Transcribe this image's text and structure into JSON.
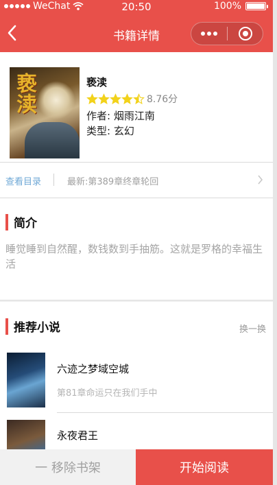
{
  "status_bar": {
    "carrier": "WeChat",
    "time": "20:50",
    "battery": "100%",
    "battery_level": 1.0
  },
  "nav": {
    "title": "书籍详情"
  },
  "book": {
    "cover_text": "亵渎",
    "name": "亵渎",
    "rating_stars": 4.5,
    "rating_text": "8.76分",
    "author": "作者: 烟雨江南",
    "type": "类型: 玄幻"
  },
  "catalog": {
    "link_label": "查看目录",
    "latest": "最新:第389章终章轮回"
  },
  "intro": {
    "heading": "简介",
    "text": "睡觉睡到自然醒，数钱数到手抽筋。这就是罗格的幸福生活"
  },
  "recommend": {
    "heading": "推荐小说",
    "refresh_label": "换一换",
    "items": [
      {
        "title": "六迹之梦域空城",
        "subtitle": "第81章命运只在我们手中"
      },
      {
        "title": "永夜君王",
        "subtitle": ""
      }
    ]
  },
  "actions": {
    "remove_label": "一 移除书架",
    "read_label": "开始阅读"
  },
  "colors": {
    "accent": "#e8504a",
    "link": "#6fa8d6",
    "star": "#f2d21b",
    "muted": "#a5a5a5"
  },
  "icons": [
    "back-icon",
    "more-icon",
    "close-icon",
    "star-icon",
    "chevron-right-icon",
    "wifi-icon",
    "battery-icon"
  ]
}
